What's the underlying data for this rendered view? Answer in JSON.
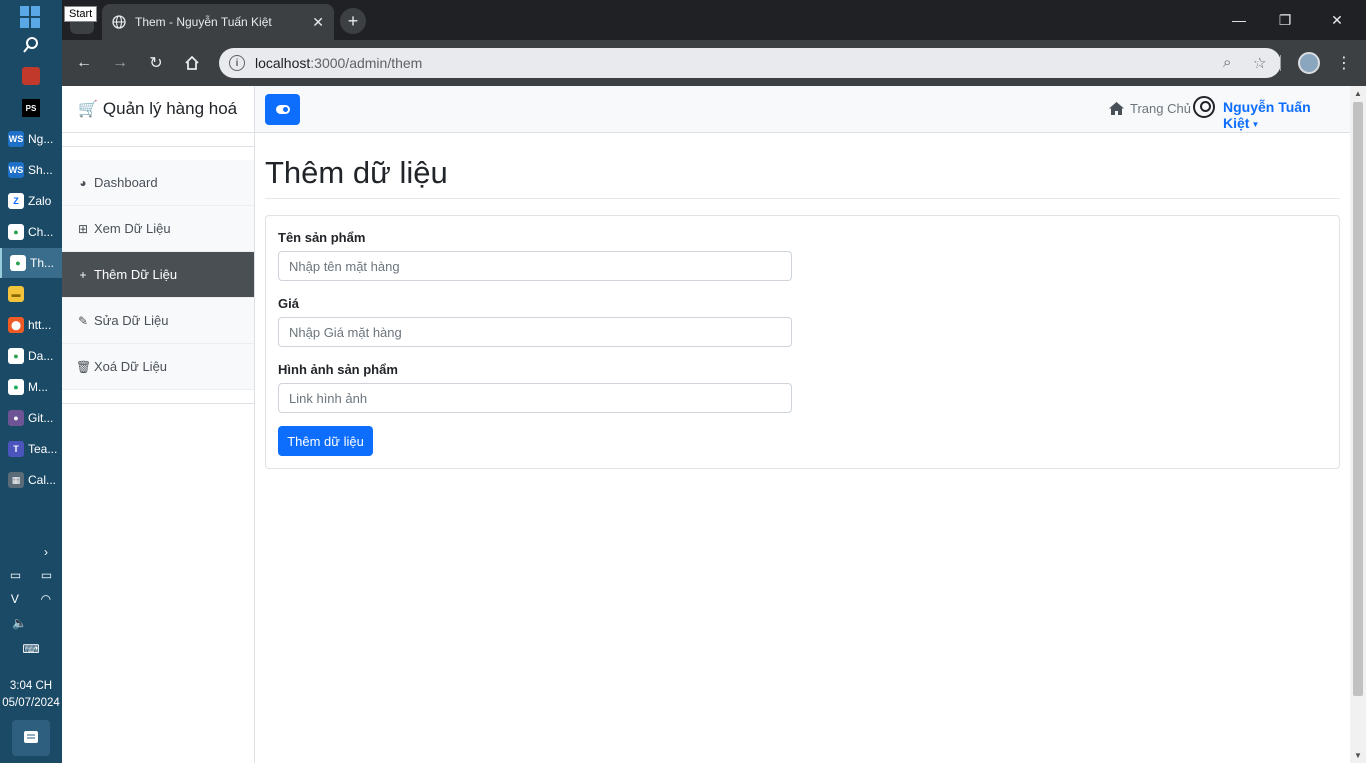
{
  "taskbar": {
    "start_tooltip": "Start",
    "apps": [
      {
        "label": "Ng...",
        "icon": "webstorm-icon",
        "badge": "WS"
      },
      {
        "label": "Sh...",
        "icon": "webstorm-icon",
        "badge": "WS"
      },
      {
        "label": "Zalo",
        "icon": "zalo-icon",
        "badge": "Z"
      },
      {
        "label": "Ch...",
        "icon": "chrome-icon",
        "badge": "●"
      },
      {
        "label": "Th...",
        "icon": "chrome-icon",
        "badge": "●"
      },
      {
        "label": "",
        "icon": "file-explorer-icon",
        "badge": "▬"
      },
      {
        "label": "htt...",
        "icon": "postman-icon",
        "badge": "⬤"
      },
      {
        "label": "Da...",
        "icon": "chrome-icon",
        "badge": "●"
      },
      {
        "label": "M...",
        "icon": "mongodb-icon",
        "badge": "●"
      },
      {
        "label": "Git...",
        "icon": "github-icon",
        "badge": "●"
      },
      {
        "label": "Tea...",
        "icon": "teams-icon",
        "badge": "T"
      },
      {
        "label": "Cal...",
        "icon": "calculator-icon",
        "badge": "▦"
      }
    ],
    "clock_time": "3:04 CH",
    "clock_date": "05/07/2024"
  },
  "browser": {
    "tab_title": "Them - Nguyễn Tuấn Kiệt",
    "url_host": "localhost",
    "url_path": ":3000/admin/them"
  },
  "sidebar": {
    "brand": "Quản lý hàng hoá",
    "items": [
      {
        "label": "Dashboard",
        "icon": "palette-icon",
        "glyph": "◕"
      },
      {
        "label": "Xem Dữ Liệu",
        "icon": "table-icon",
        "glyph": "⊞"
      },
      {
        "label": "Thêm Dữ Liệu",
        "icon": "plus-icon",
        "glyph": "+"
      },
      {
        "label": "Sửa Dữ Liệu",
        "icon": "pencil-icon",
        "glyph": "✎"
      },
      {
        "label": "Xoá Dữ Liệu",
        "icon": "trash-icon",
        "glyph": "🗑"
      }
    ]
  },
  "topnav": {
    "home_label": "Trang Chủ",
    "user_name": "Nguyễn Tuấn Kiệt"
  },
  "main": {
    "title": "Thêm dữ liệu",
    "form": {
      "name_label": "Tên sản phẩm",
      "name_placeholder": "Nhập tên mặt hàng",
      "price_label": "Giá",
      "price_placeholder": "Nhập Giá mặt hàng",
      "image_label": "Hình ảnh sản phẩm",
      "image_placeholder": "Link hình ảnh",
      "submit_label": "Thêm dữ liệu"
    }
  },
  "colors": {
    "primary": "#0d6efd",
    "sidebar_active": "#4a4f54",
    "taskbar": "#1b4a66"
  }
}
